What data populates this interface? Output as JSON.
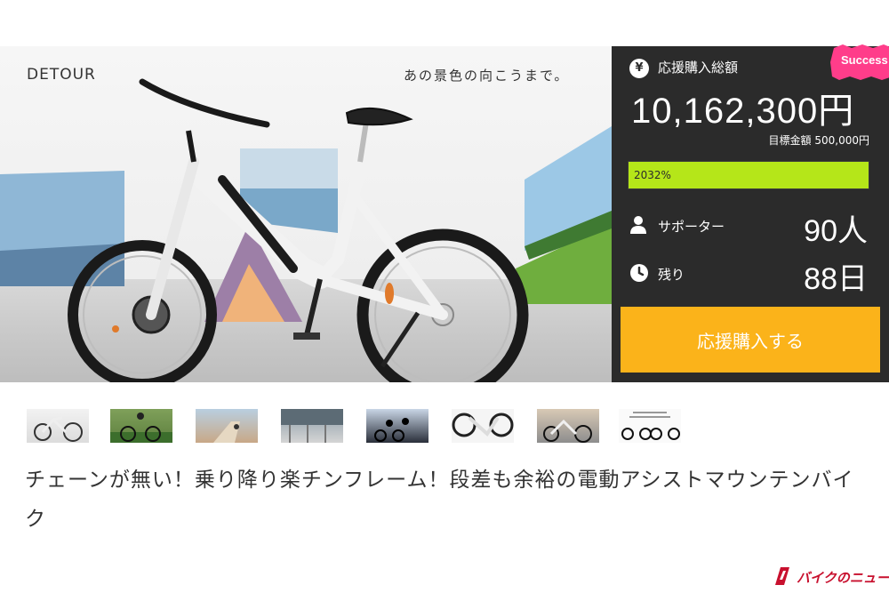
{
  "hero": {
    "brand": "DETOUR",
    "tagline": "あの景色の向こうまで。"
  },
  "funding": {
    "currency_symbol": "¥",
    "total_label": "応援購入総額",
    "total_amount": "10,162,300円",
    "goal_text": "目標金額 500,000円",
    "progress_text": "2032%",
    "progress_fill_fraction": 1.0,
    "supporters_label": "サポーター",
    "supporters_value": "90人",
    "remaining_label": "残り",
    "remaining_value": "88日",
    "cta_label": "応援購入する",
    "status_badge": "Success",
    "colors": {
      "panel": "#2b2b2b",
      "progress": "#b5e619",
      "cta": "#fbb31a",
      "badge": "#ff3d8a"
    }
  },
  "thumbnails": [
    {
      "name": "thumb-bike-studio"
    },
    {
      "name": "thumb-riding-green"
    },
    {
      "name": "thumb-riding-path"
    },
    {
      "name": "thumb-parked-building"
    },
    {
      "name": "thumb-sunset-silhouette"
    },
    {
      "name": "thumb-step-through-frame"
    },
    {
      "name": "thumb-bike-outdoor"
    },
    {
      "name": "thumb-two-colors"
    }
  ],
  "product": {
    "title": "チェーンが無い！乗り降り楽チンフレーム！段差も余裕の電動アシストマウンテンバイク"
  },
  "watermark": {
    "text": "バイクのニュース"
  }
}
